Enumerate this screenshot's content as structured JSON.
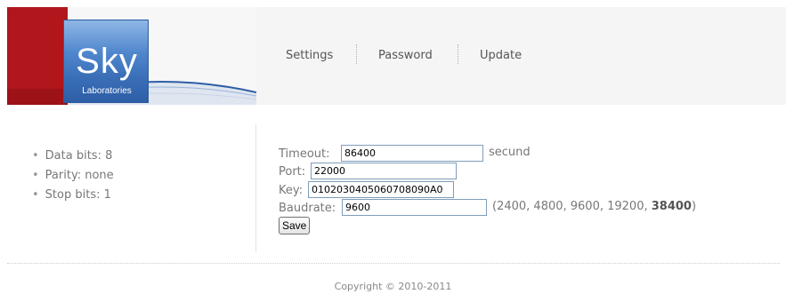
{
  "header": {
    "logo": {
      "brand": "Sky",
      "subtitle": "Laboratories"
    },
    "nav": [
      {
        "label": "Settings"
      },
      {
        "label": "Password"
      },
      {
        "label": "Update"
      }
    ]
  },
  "info": {
    "items": [
      "Data bits: 8",
      "Parity: none",
      "Stop bits: 1"
    ]
  },
  "form": {
    "timeout": {
      "label": "Timeout:",
      "value": "86400",
      "unit": "secund"
    },
    "port": {
      "label": "Port:",
      "value": "22000"
    },
    "key": {
      "label": "Key:",
      "value": "0102030405060708090A0"
    },
    "baudrate": {
      "label": "Baudrate:",
      "value": "9600",
      "options_text": "(2400, 4800, 9600, 19200, ",
      "options_bold": "38400",
      "options_close": ")"
    },
    "save_label": "Save"
  },
  "footer": {
    "copyright": "Copyright © 2010-2011"
  },
  "colors": {
    "brand_red": "#b0161c",
    "logo_blue": "#3a6fb8"
  }
}
